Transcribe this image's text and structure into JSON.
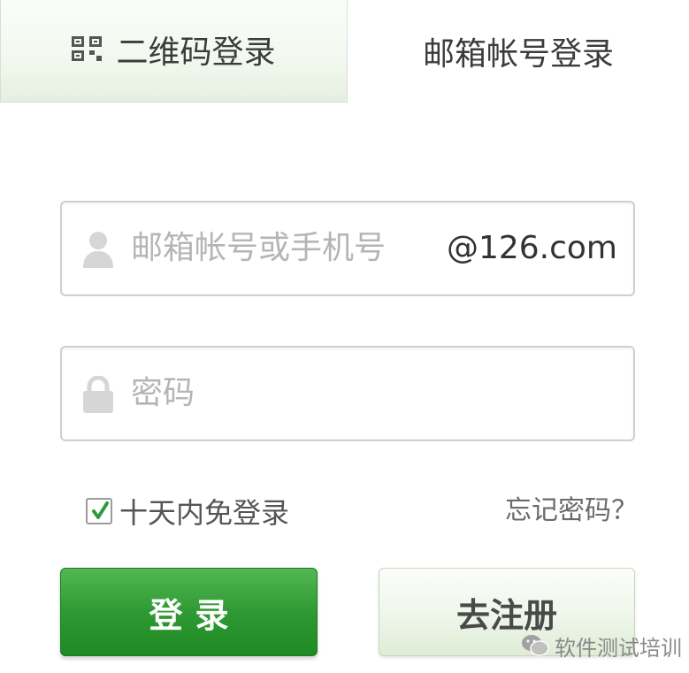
{
  "tabs": {
    "qr_label": "二维码登录",
    "mail_label": "邮箱帐号登录"
  },
  "form": {
    "username_placeholder": "邮箱帐号或手机号",
    "domain_suffix": "@126.com",
    "password_placeholder": "密码",
    "remember_label": "十天内免登录",
    "remember_checked": true,
    "forgot_label": "忘记密码？"
  },
  "buttons": {
    "login_label": "登录",
    "register_label": "去注册"
  },
  "watermark": {
    "text": "软件测试培训"
  },
  "colors": {
    "primary_green": "#2f9a33",
    "check_green": "#2e9b3a",
    "placeholder_gray": "#b5b5b5"
  },
  "icons": {
    "qr": "qr-code-icon",
    "user": "user-icon",
    "lock": "lock-icon",
    "check": "checkmark-icon",
    "watermark_logo": "wechat-logo-icon"
  }
}
